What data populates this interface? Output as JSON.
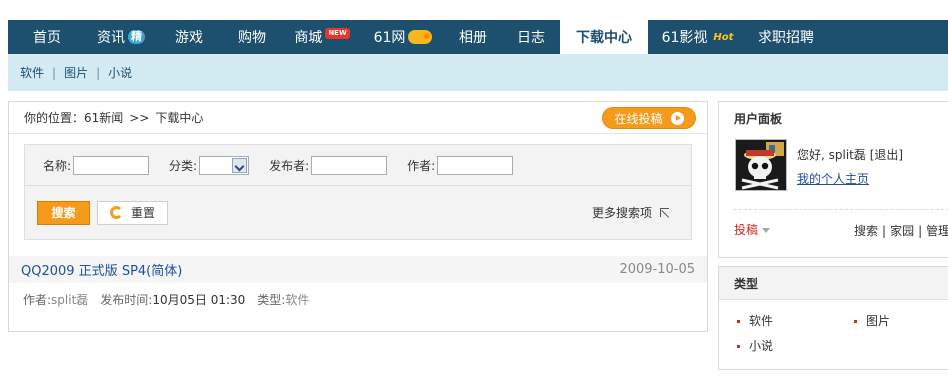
{
  "nav": {
    "items": [
      {
        "label": "首页"
      },
      {
        "label": "资讯",
        "badge": "精"
      },
      {
        "label": "游戏"
      },
      {
        "label": "购物"
      },
      {
        "label": "商城",
        "badge": "NEW"
      },
      {
        "label": "61网"
      },
      {
        "label": "相册"
      },
      {
        "label": "日志"
      },
      {
        "label": "下载中心",
        "active": true
      },
      {
        "label": "61影视",
        "badge": "Hot"
      },
      {
        "label": "求职招聘"
      }
    ]
  },
  "subnav": {
    "items": [
      "软件",
      "图片",
      "小说"
    ],
    "separator": "|"
  },
  "breadcrumb": {
    "prefix": "你的位置：",
    "home": "61新闻",
    "separator": ">>",
    "current": "下载中心"
  },
  "submit_button": "在线投稿",
  "search": {
    "name_label": "名称:",
    "category_label": "分类:",
    "publisher_label": "发布者:",
    "author_label": "作者:",
    "search_button": "搜索",
    "reset_button": "重置",
    "more_search": "更多搜索项"
  },
  "results": [
    {
      "title": "QQ2009 正式版 SP4(简体)",
      "date": "2009-10-05",
      "author_label": "作者:",
      "author": "split磊",
      "time_label": "发布时间:",
      "time": "10月05日 01:30",
      "type_label": "类型:",
      "type": "软件"
    }
  ],
  "user_panel": {
    "title": "用户面板",
    "greeting": "您好, split磊",
    "logout": "[退出]",
    "homepage_link": "我的个人主页",
    "tougao": "投稿",
    "links": [
      "搜索",
      "家园",
      "管理"
    ]
  },
  "type_panel": {
    "title": "类型",
    "items": [
      "软件",
      "图片",
      "小说"
    ]
  },
  "colors": {
    "nav_bg": "#1d4f6e",
    "subnav_bg": "#d3ecf3",
    "accent_orange": "#f59a1b",
    "link_blue": "#1d4f9a"
  }
}
